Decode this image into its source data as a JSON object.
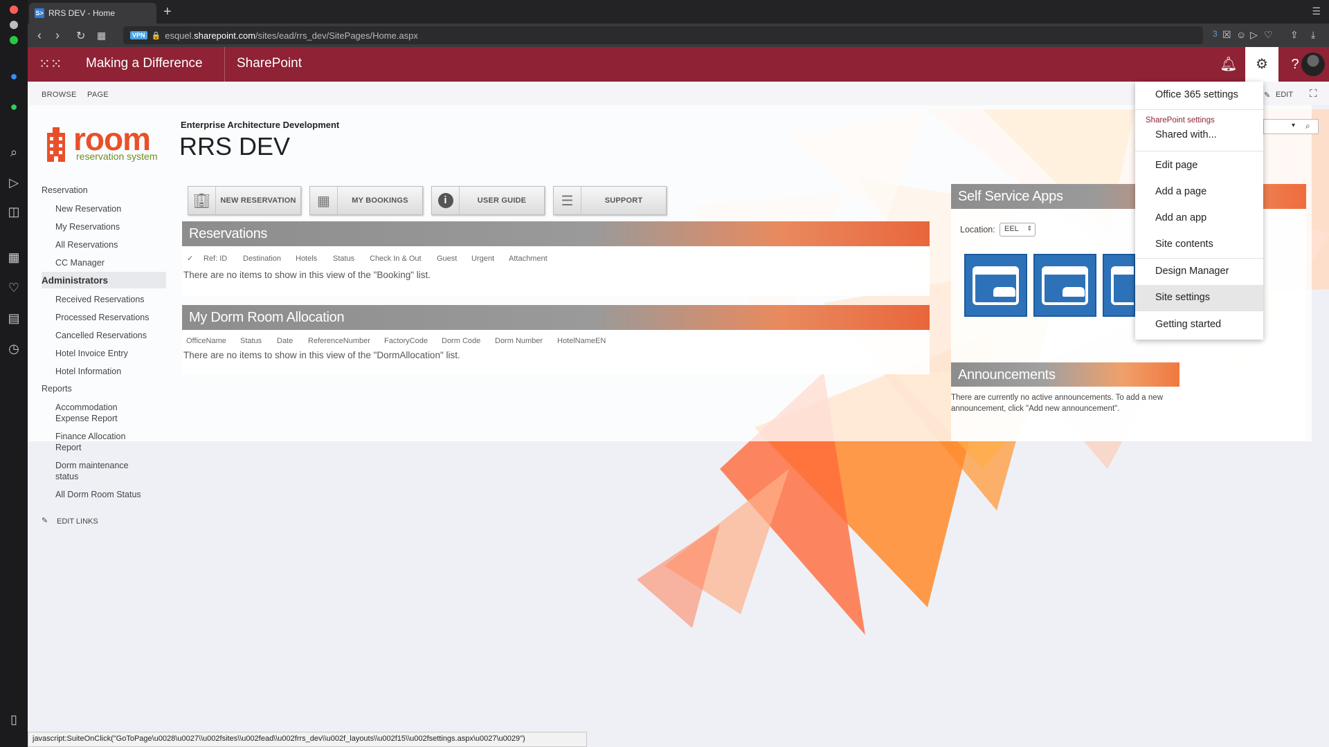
{
  "browser": {
    "tab_title": "RRS DEV - Home",
    "favicon_text": "S>",
    "vpn_label": "VPN",
    "url_prefix": "esquel.",
    "url_host": "sharepoint.com",
    "url_path": "/sites/ead/rrs_dev/SitePages/Home.aspx",
    "badge_count": "3"
  },
  "suite": {
    "brand": "Making a Difference",
    "product": "SharePoint"
  },
  "ribbon": {
    "browse": "BROWSE",
    "page": "PAGE",
    "edit": "EDIT"
  },
  "logo": {
    "word": "room",
    "tagline": "reservation system"
  },
  "site": {
    "description": "Enterprise Architecture Development",
    "title": "RRS DEV"
  },
  "leftnav": {
    "reservation": "Reservation",
    "new_reservation": "New Reservation",
    "my_reservations": "My Reservations",
    "all_reservations": "All Reservations",
    "cc_manager": "CC Manager",
    "administrators": "Administrators",
    "received": "Received Reservations",
    "processed": "Processed Reservations",
    "cancelled": "Cancelled Reservations",
    "hotel_invoice": "Hotel Invoice Entry",
    "hotel_info": "Hotel Information",
    "reports": "Reports",
    "accommodation": "Accommodation Expense Report",
    "finance": "Finance Allocation Report",
    "dorm_maint": "Dorm maintenance status",
    "all_dorm": "All Dorm Room Status",
    "edit_links": "EDIT LINKS"
  },
  "quick_buttons": {
    "new_reservation": "NEW RESERVATION",
    "my_bookings": "MY BOOKINGS",
    "user_guide": "USER GUIDE",
    "support": "SUPPORT"
  },
  "reservations": {
    "title": "Reservations",
    "columns": [
      "Ref: ID",
      "Destination",
      "Hotels",
      "Status",
      "Check In & Out",
      "Guest",
      "Urgent",
      "Attachment"
    ],
    "empty": "There are no items to show in this view of the \"Booking\" list."
  },
  "dorm": {
    "title": "My Dorm Room Allocation",
    "columns": [
      "OfficeName",
      "Status",
      "Date",
      "ReferenceNumber",
      "FactoryCode",
      "Dorm Code",
      "Dorm Number",
      "HotelNameEN"
    ],
    "empty": "There are no items to show in this view of the \"DormAllocation\" list."
  },
  "self_service": {
    "title": "Self Service Apps",
    "location_label": "Location:",
    "location_value": "EEL"
  },
  "announcements": {
    "title": "Announcements",
    "text": "There are currently no active announcements. To add a new announcement, click \"Add new announcement\"."
  },
  "settings_menu": {
    "office365": "Office 365 settings",
    "sp_settings_header": "SharePoint settings",
    "shared_with": "Shared with...",
    "edit_page": "Edit page",
    "add_page": "Add a page",
    "add_app": "Add an app",
    "site_contents": "Site contents",
    "design_manager": "Design Manager",
    "site_settings": "Site settings",
    "getting_started": "Getting started"
  },
  "status_bar": "javascript:SuiteOnClick(\"GoToPage\\u0028\\u0027\\\\u002fsites\\\\u002fead\\\\u002frrs_dev\\\\u002f_layouts\\\\u002f15\\\\u002fsettings.aspx\\u0027\\u0029\")",
  "colors": {
    "suite_bar": "#8f2235",
    "logo_orange": "#e8502a",
    "tile_blue": "#2d72b8"
  }
}
